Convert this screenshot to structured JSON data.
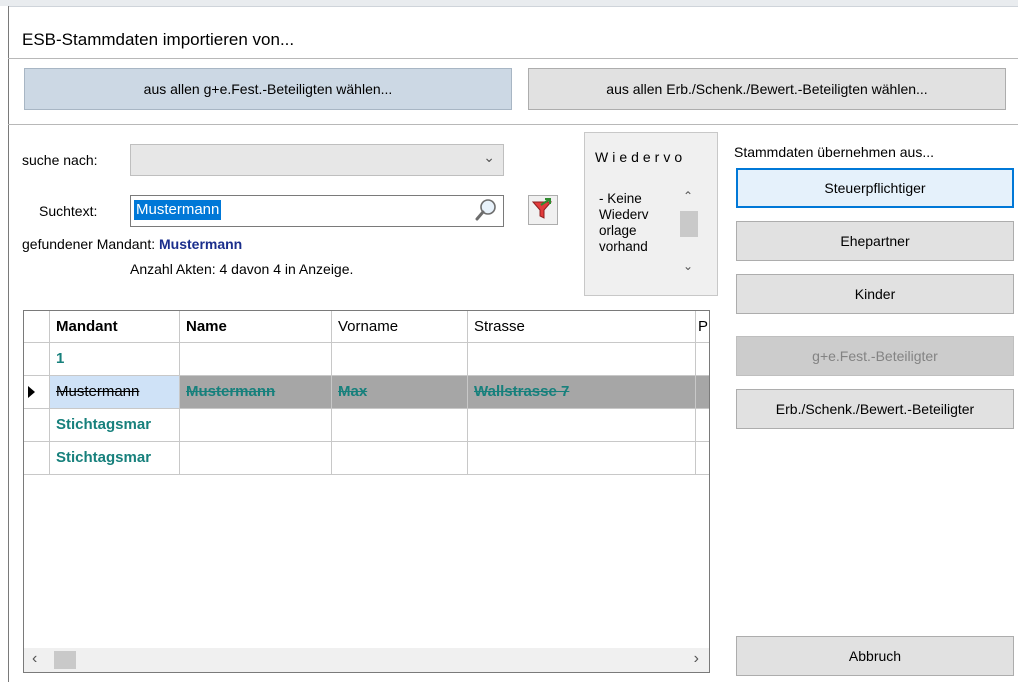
{
  "dialog": {
    "title": "ESB-Stammdaten importieren von..."
  },
  "top_buttons": {
    "from_ge_fest": "aus allen g+e.Fest.-Beteiligten wählen...",
    "from_erb": "aus allen Erb./Schenk./Bewert.-Beteiligten wählen..."
  },
  "search": {
    "suche_nach_label": "suche nach:",
    "suche_nach_value": "",
    "suchtext_label": "Suchtext:",
    "suchtext_value": "Mustermann",
    "found_label": "gefundener Mandant:",
    "found_value": "Mustermann",
    "count_text": "Anzahl Akten: 4 davon 4 in Anzeige."
  },
  "memo": {
    "title": "Wiedervo",
    "text": "- Keine Wiederv orlage vorhand"
  },
  "right_panel": {
    "heading": "Stammdaten übernehmen aus...",
    "steuerpflichtiger": "Steuerpflichtiger",
    "ehepartner": "Ehepartner",
    "kinder": "Kinder",
    "ge_fest": "g+e.Fest.-Beteiligter",
    "erb": "Erb./Schenk./Bewert.-Beteiligter",
    "abbruch": "Abbruch"
  },
  "table": {
    "columns": [
      "Mandant",
      "Name",
      "Vorname",
      "Strasse",
      "P"
    ],
    "rows": [
      [
        "1",
        "",
        "",
        "",
        ""
      ],
      [
        "Mustermann",
        "Mustermann",
        "Max",
        "Wallstrasse 7",
        ""
      ],
      [
        "Stichtagsmar",
        "",
        "",
        "",
        ""
      ],
      [
        "Stichtagsmar",
        "",
        "",
        "",
        ""
      ]
    ]
  },
  "colors": {
    "accent": "#0078d7",
    "teal_text": "#17807c",
    "found_text": "#1a2e8c"
  },
  "icons": [
    "search-icon",
    "filter-icon",
    "row-indicator-icon",
    "chevron-down-icon"
  ]
}
